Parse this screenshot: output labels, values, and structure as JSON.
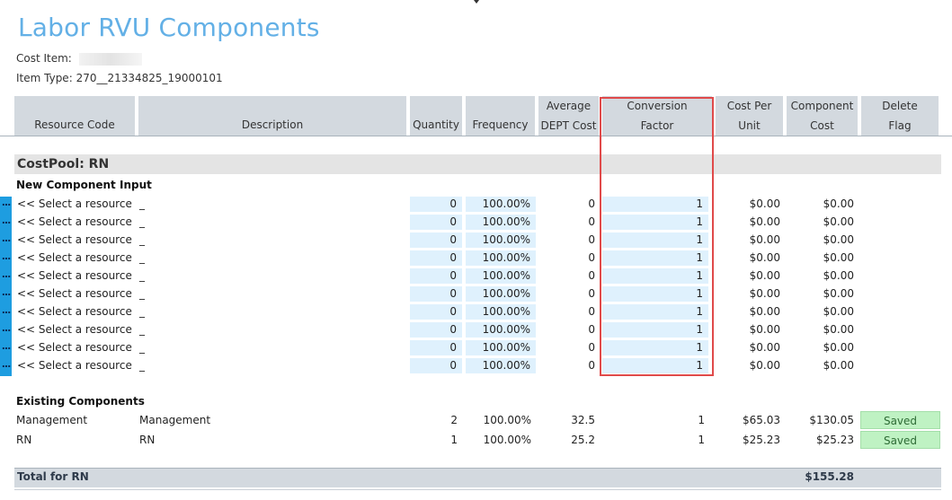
{
  "page": {
    "title": "Labor RVU Components",
    "cost_item_label": "Cost Item:",
    "item_type_label": "Item Type:",
    "item_type_value": "270__21334825_19000101"
  },
  "columns": {
    "resource_code": "Resource Code",
    "description": "Description",
    "quantity": "Quantity",
    "frequency": "Frequency",
    "avg_dept_cost_1": "Average",
    "avg_dept_cost_2": "DEPT Cost",
    "conversion_factor_1": "Conversion",
    "conversion_factor_2": "Factor",
    "cost_per_unit_1": "Cost Per",
    "cost_per_unit_2": "Unit",
    "component_cost_1": "Component",
    "component_cost_2": "Cost",
    "delete_flag_1": "Delete",
    "delete_flag_2": "Flag"
  },
  "section": {
    "title": "CostPool: RN",
    "new_input_label": "New Component Input",
    "existing_label": "Existing Components"
  },
  "new_rows": [
    {
      "select": "<< Select a resource",
      "desc": "_",
      "qty": "0",
      "freq": "100.00%",
      "avg": "0",
      "conv": "1",
      "cpu": "$0.00",
      "comp": "$0.00"
    },
    {
      "select": "<< Select a resource",
      "desc": "_",
      "qty": "0",
      "freq": "100.00%",
      "avg": "0",
      "conv": "1",
      "cpu": "$0.00",
      "comp": "$0.00"
    },
    {
      "select": "<< Select a resource",
      "desc": "_",
      "qty": "0",
      "freq": "100.00%",
      "avg": "0",
      "conv": "1",
      "cpu": "$0.00",
      "comp": "$0.00"
    },
    {
      "select": "<< Select a resource",
      "desc": "_",
      "qty": "0",
      "freq": "100.00%",
      "avg": "0",
      "conv": "1",
      "cpu": "$0.00",
      "comp": "$0.00"
    },
    {
      "select": "<< Select a resource",
      "desc": "_",
      "qty": "0",
      "freq": "100.00%",
      "avg": "0",
      "conv": "1",
      "cpu": "$0.00",
      "comp": "$0.00"
    },
    {
      "select": "<< Select a resource",
      "desc": "_",
      "qty": "0",
      "freq": "100.00%",
      "avg": "0",
      "conv": "1",
      "cpu": "$0.00",
      "comp": "$0.00"
    },
    {
      "select": "<< Select a resource",
      "desc": "_",
      "qty": "0",
      "freq": "100.00%",
      "avg": "0",
      "conv": "1",
      "cpu": "$0.00",
      "comp": "$0.00"
    },
    {
      "select": "<< Select a resource",
      "desc": "_",
      "qty": "0",
      "freq": "100.00%",
      "avg": "0",
      "conv": "1",
      "cpu": "$0.00",
      "comp": "$0.00"
    },
    {
      "select": "<< Select a resource",
      "desc": "_",
      "qty": "0",
      "freq": "100.00%",
      "avg": "0",
      "conv": "1",
      "cpu": "$0.00",
      "comp": "$0.00"
    },
    {
      "select": "<< Select a resource",
      "desc": "_",
      "qty": "0",
      "freq": "100.00%",
      "avg": "0",
      "conv": "1",
      "cpu": "$0.00",
      "comp": "$0.00"
    }
  ],
  "existing_rows": [
    {
      "code": "Management",
      "desc": "Management",
      "qty": "2",
      "freq": "100.00%",
      "avg": "32.5",
      "conv": "1",
      "cpu": "$65.03",
      "comp": "$130.05",
      "flag": "Saved"
    },
    {
      "code": "RN",
      "desc": "RN",
      "qty": "1",
      "freq": "100.00%",
      "avg": "25.2",
      "conv": "1",
      "cpu": "$25.23",
      "comp": "$25.23",
      "flag": "Saved"
    }
  ],
  "total": {
    "label": "Total for RN",
    "value": "$155.28"
  },
  "row_more_glyph": "...",
  "colors": {
    "title": "#63b0e6",
    "header_bg": "#d3d9df",
    "input_bg": "#dff1fd",
    "row_handle": "#1e9de0",
    "saved_bg": "#bff2c3",
    "highlight": "#e04a4a"
  }
}
